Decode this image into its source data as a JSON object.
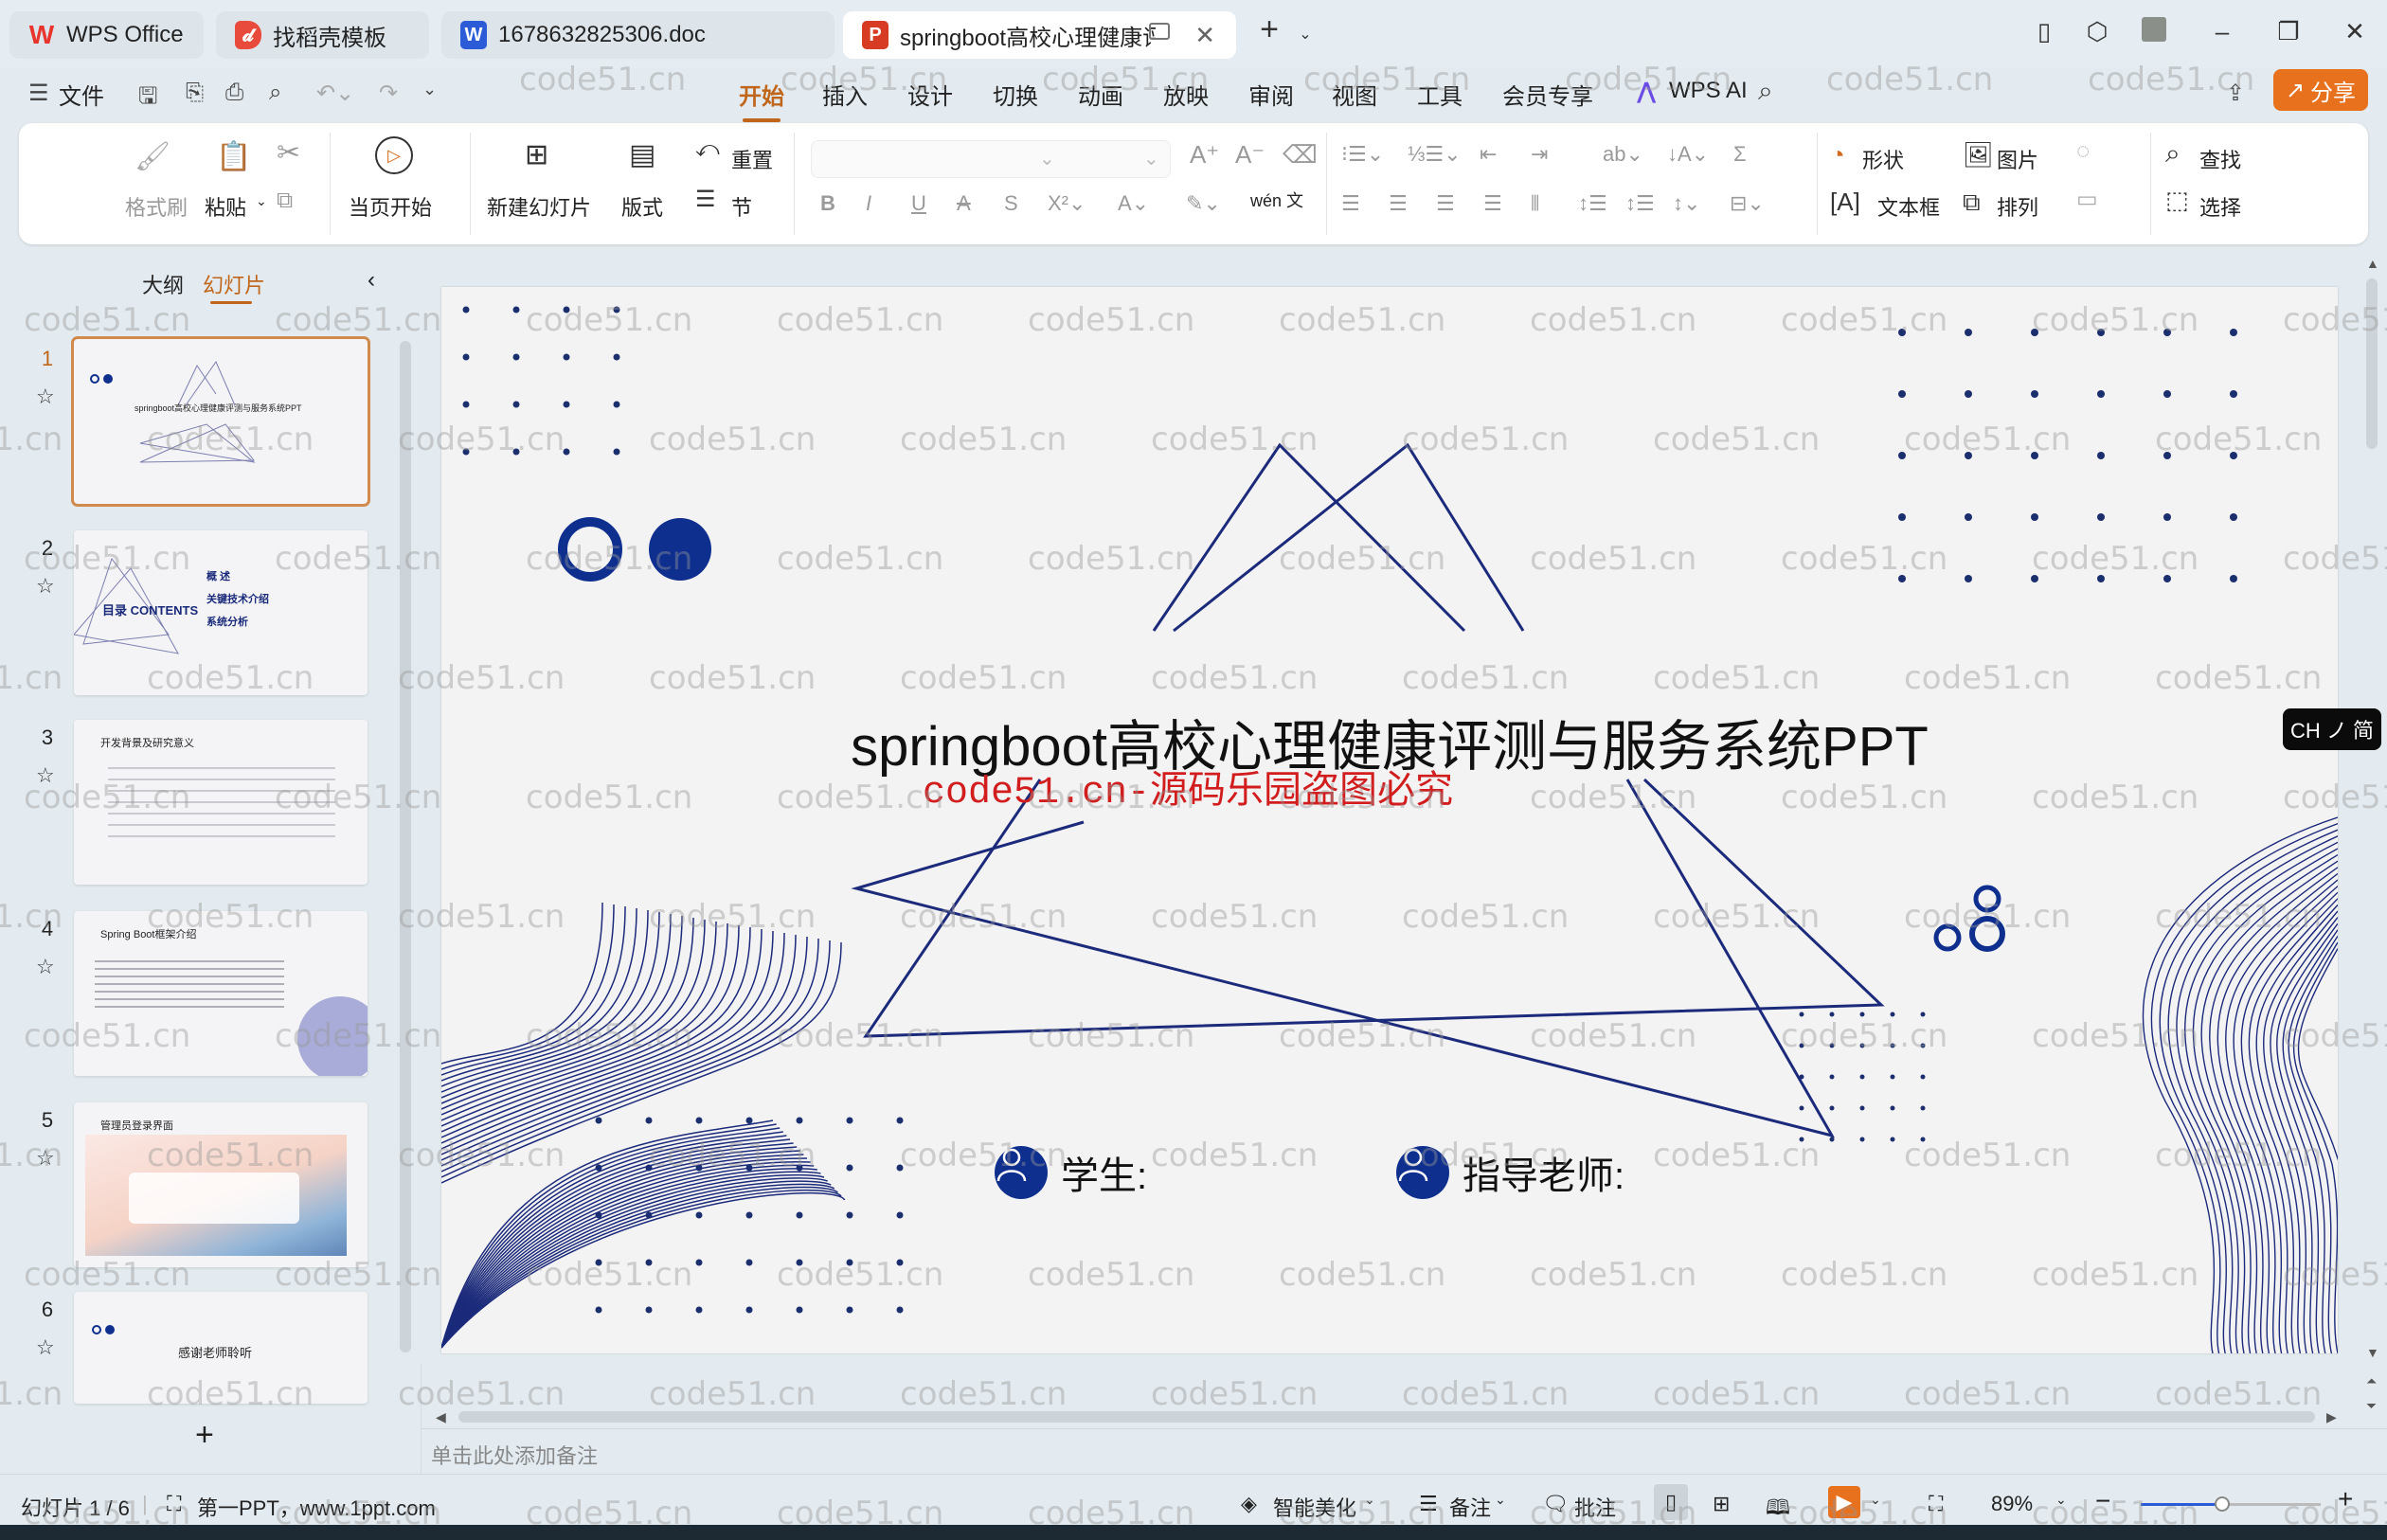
{
  "titlebar": {
    "tabs": [
      {
        "label": "WPS Office",
        "icon": "wps-logo-icon",
        "color": "#e8342c"
      },
      {
        "label": "找稻壳模板",
        "icon": "docer-icon",
        "color": "#e84b3c"
      },
      {
        "label": "1678632825306.doc",
        "icon": "word-doc-icon",
        "color": "#2b5bd7"
      },
      {
        "label": "springboot高校心理健康评测",
        "icon": "ppt-icon",
        "color": "#d83b24",
        "active": true
      }
    ],
    "new_tab": "+",
    "window_buttons": [
      "minimize",
      "restore",
      "close"
    ]
  },
  "menu": {
    "file_label": "文件",
    "tabs": [
      "开始",
      "插入",
      "设计",
      "切换",
      "动画",
      "放映",
      "审阅",
      "视图",
      "工具",
      "会员专享"
    ],
    "active_tab": "开始",
    "wps_ai_label": "WPS AI",
    "share_label": "分享",
    "accent": "#c0661b",
    "share_color": "#e8711e"
  },
  "ribbon": {
    "format_painter": "格式刷",
    "paste": "粘贴",
    "play_from_current": "当页开始",
    "new_slide": "新建幻灯片",
    "layout": "版式",
    "reset": "重置",
    "section": "节",
    "shape": "形状",
    "picture": "图片",
    "textbox": "文本框",
    "arrange": "排列",
    "find": "查找",
    "select": "选择",
    "pinyin": "wén 文"
  },
  "left_panel": {
    "tab_outline": "大纲",
    "tab_slides": "幻灯片",
    "active": "幻灯片",
    "add_slide": "+",
    "slides": [
      {
        "num": "1",
        "title": "springboot高校心理健康评测与服务系统PPT",
        "selected": true
      },
      {
        "num": "2",
        "title": "目录 CONTENTS",
        "items": [
          "概 述",
          "关键技术介绍",
          "系统分析"
        ]
      },
      {
        "num": "3",
        "title": "开发背景及研究意义"
      },
      {
        "num": "4",
        "title": "Spring Boot框架介绍"
      },
      {
        "num": "5",
        "title": "管理员登录界面"
      },
      {
        "num": "6",
        "title": "感谢老师聆听"
      }
    ]
  },
  "slide": {
    "title": "springboot高校心理健康评测与服务系统PPT",
    "watermark_text": "code51.cn-源码乐园盗图必究",
    "student_label": "学生:",
    "teacher_label": "指导老师:",
    "primary_color": "#0f2f8f",
    "line_color": "#1b2a7a"
  },
  "notes": {
    "placeholder": "单击此处添加备注"
  },
  "statusbar": {
    "slide_counter": "幻灯片 1 / 6",
    "theme_label": "第一PPT，www.1ppt.com",
    "beautify": "智能美化",
    "notes": "备注",
    "comment": "批注",
    "zoom": "89%",
    "zoom_fraction": 0.45
  },
  "ime": {
    "label": "CH ノ 简"
  },
  "background_watermark": "code51.cn"
}
